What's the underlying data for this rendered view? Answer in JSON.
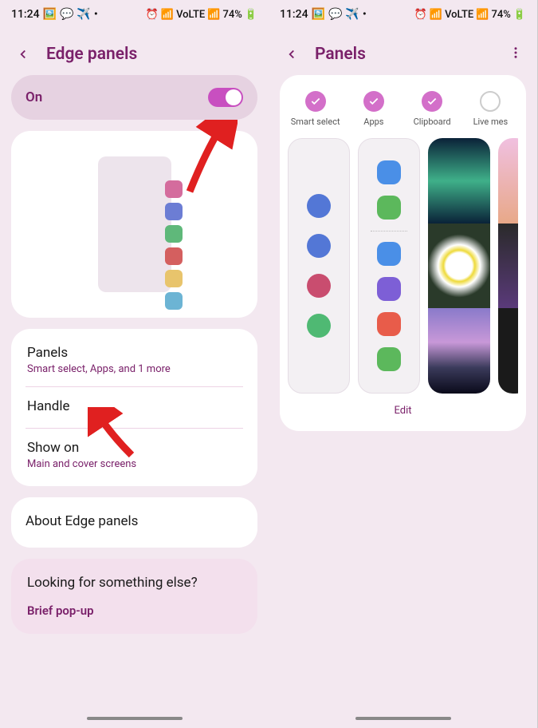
{
  "statusbar": {
    "time": "11:24",
    "battery": "74%",
    "signal_label": "VoLTE"
  },
  "left_screen": {
    "title": "Edge panels",
    "toggle_label": "On",
    "panels": {
      "label": "Panels",
      "subtitle": "Smart select, Apps, and 1 more"
    },
    "handle_label": "Handle",
    "show_on": {
      "label": "Show on",
      "subtitle": "Main and cover screens"
    },
    "about_label": "About Edge panels",
    "suggestion_title": "Looking for something else?",
    "suggestion_link": "Brief pop-up"
  },
  "right_screen": {
    "title": "Panels",
    "selectors": [
      {
        "label": "Smart select",
        "checked": true
      },
      {
        "label": "Apps",
        "checked": true
      },
      {
        "label": "Clipboard",
        "checked": true
      },
      {
        "label": "Live mes",
        "checked": false
      }
    ],
    "edit_label": "Edit"
  },
  "colors": {
    "accent": "#7a216a",
    "toggle_on": "#c84fc0"
  }
}
